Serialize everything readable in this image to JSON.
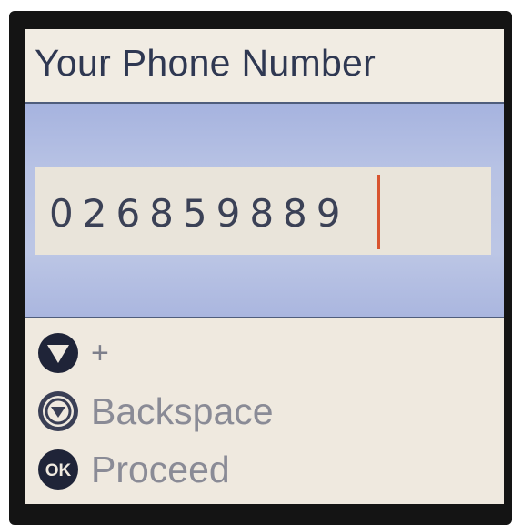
{
  "screen": {
    "title": "Your Phone Number"
  },
  "input": {
    "value": "026859889"
  },
  "legend": {
    "items": [
      {
        "icon": "down-arrow-button-icon",
        "label": "+"
      },
      {
        "icon": "down-ring-button-icon",
        "label": "Backspace"
      },
      {
        "icon": "ok-button-icon",
        "label": "Proceed"
      }
    ]
  },
  "colors": {
    "title_text": "#2f3852",
    "band": "#bcc6e5",
    "cursor": "#d8542f",
    "legend_text": "#8a8b96"
  }
}
